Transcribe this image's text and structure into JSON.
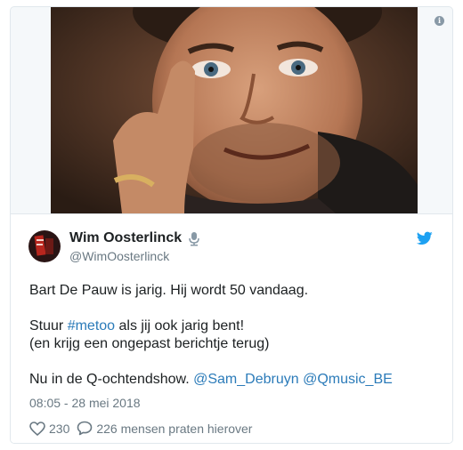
{
  "tweet": {
    "author_name": "Wim Oosterlinck",
    "author_handle": "@WimOosterlinck",
    "line1": "Bart De Pauw is jarig. Hij wordt 50 vandaag.",
    "line2_before": "Stuur ",
    "line2_hashtag": "#metoo",
    "line2_after": " als jij ook jarig bent!",
    "line3": "(en krijg een ongepast berichtje terug)",
    "line4_before": "Nu in de Q-ochtendshow. ",
    "mention1": "@Sam_Debruyn",
    "mention2": "@Qmusic_BE",
    "timestamp": "08:05 - 28 mei 2018",
    "likes": "230",
    "replies_label": "226 mensen praten hierover"
  },
  "icons": {
    "info": "info-icon",
    "verified_mic": "microphone-icon",
    "brand": "twitter-bird-icon",
    "like": "heart-icon",
    "reply": "speech-bubble-icon"
  },
  "colors": {
    "link": "#2b7bb9",
    "twitter_blue": "#1da1f2",
    "muted": "#697882",
    "text": "#1c2022"
  }
}
